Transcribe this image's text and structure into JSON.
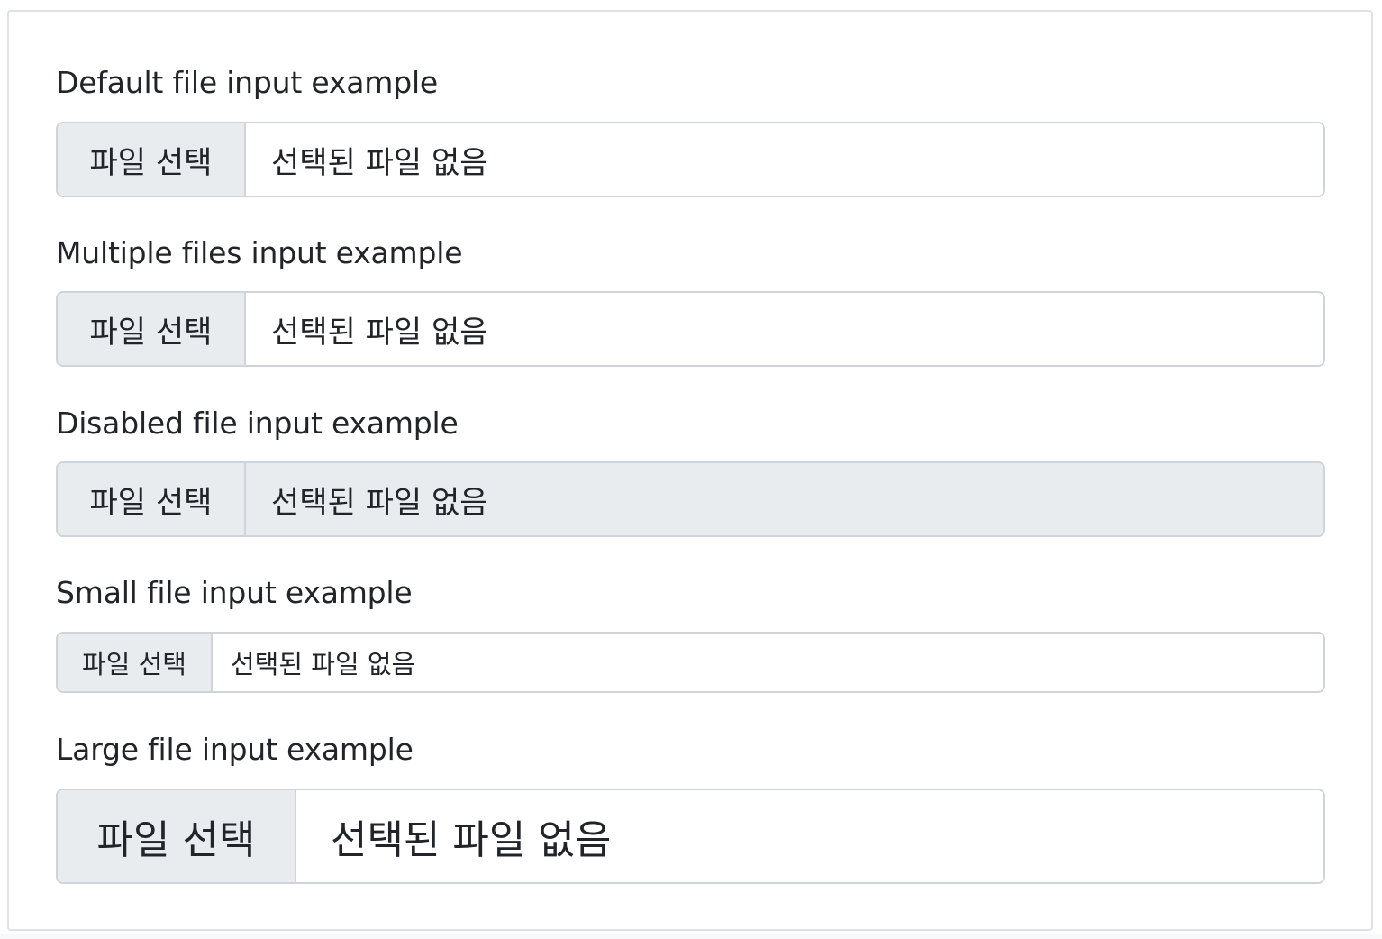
{
  "fields": [
    {
      "label": "Default file input example",
      "button": "파일 선택",
      "status": "선택된 파일 없음"
    },
    {
      "label": "Multiple files input example",
      "button": "파일 선택",
      "status": "선택된 파일 없음"
    },
    {
      "label": "Disabled file input example",
      "button": "파일 선택",
      "status": "선택된 파일 없음"
    },
    {
      "label": "Small file input example",
      "button": "파일 선택",
      "status": "선택된 파일 없음"
    },
    {
      "label": "Large file input example",
      "button": "파일 선택",
      "status": "선택된 파일 없음"
    }
  ],
  "colors": {
    "border": "#ced4da",
    "button_bg": "#e9ecef",
    "disabled_bg": "#e9ecef",
    "text": "#212529"
  }
}
